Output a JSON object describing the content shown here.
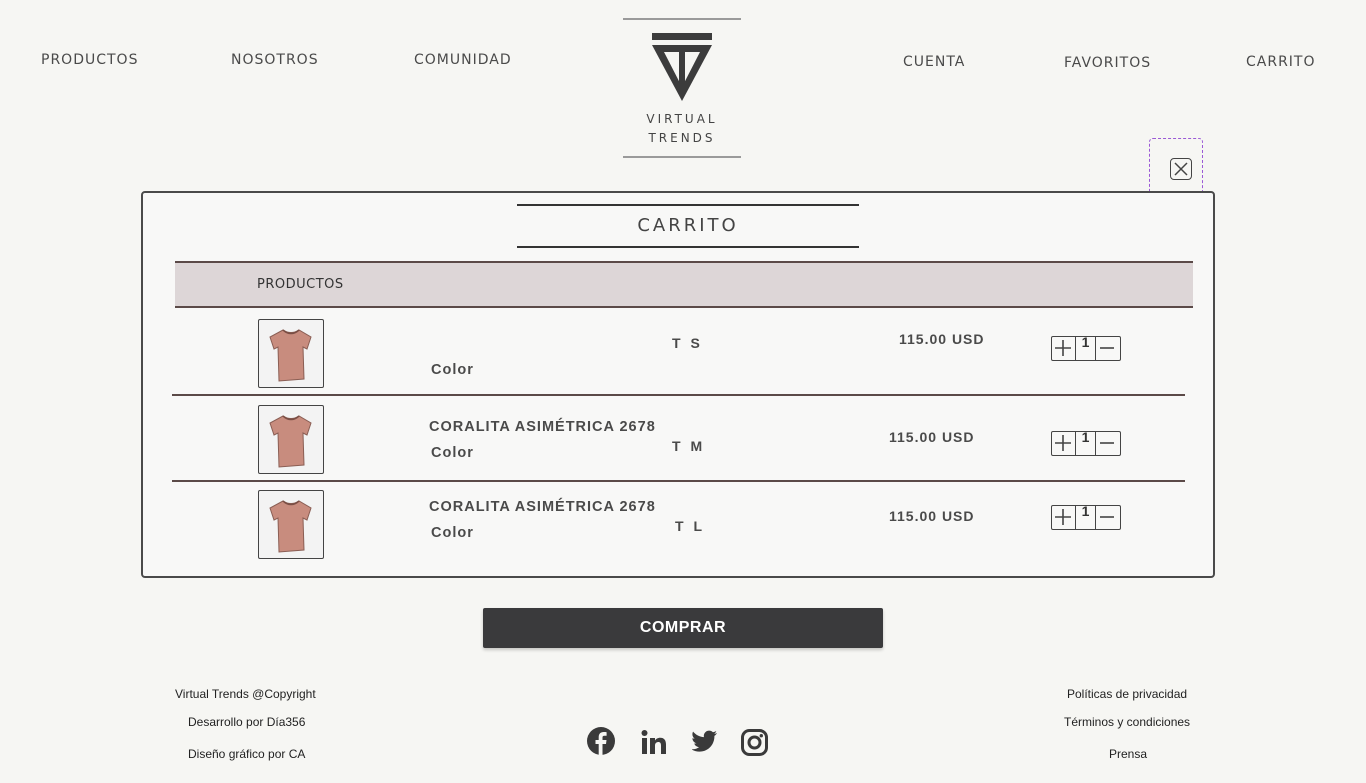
{
  "nav": {
    "left": [
      "PRODUCTOS",
      "NOSOTROS",
      "COMUNIDAD"
    ],
    "right": [
      "CUENTA",
      "FAVORITOS",
      "CARRITO"
    ]
  },
  "logo": {
    "line1": "VIRTUAL",
    "line2": "TRENDS"
  },
  "cart": {
    "title": "CARRITO",
    "column_header": "PRODUCTOS",
    "items": [
      {
        "name": "",
        "color_label": "Color",
        "size": "T S",
        "price": "115.00 USD",
        "quantity": "1"
      },
      {
        "name": "CORALITA ASIMÉTRICA 2678",
        "color_label": "Color",
        "size": "T M",
        "price": "115.00 USD",
        "quantity": "1"
      },
      {
        "name": "CORALITA ASIMÉTRICA 2678",
        "color_label": "Color",
        "size": "T L",
        "price": "115.00 USD",
        "quantity": "1"
      }
    ]
  },
  "buy_button": "COMPRAR",
  "footer": {
    "left": [
      "Virtual Trends @Copyright",
      "Desarrollo por Día356",
      "Diseño gráfico por CA"
    ],
    "right": [
      "Políticas de privacidad",
      "Términos y condiciones",
      "Prensa"
    ],
    "social_icons": [
      "facebook-icon",
      "linkedin-icon",
      "twitter-icon",
      "instagram-icon"
    ]
  },
  "colors": {
    "accent_dark": "#3a3a3c",
    "header_row": "#ddd6d7",
    "divider": "#5b4a48",
    "product_tint": "#c88c7e"
  }
}
